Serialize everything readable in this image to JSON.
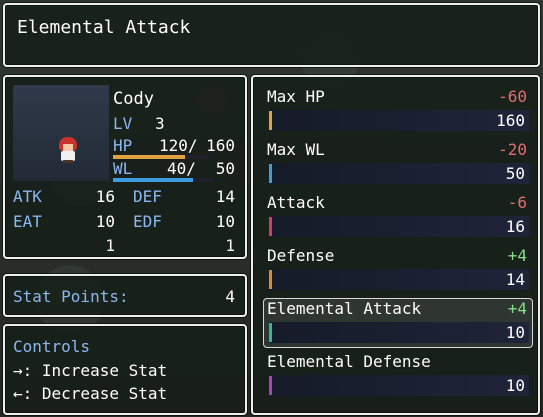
{
  "help": {
    "text": "Elemental Attack"
  },
  "actor": {
    "name": "Cody",
    "lv_label": "LV",
    "level": "3",
    "hp_label": "HP",
    "hp": "120/",
    "hp_max": "160",
    "hp_fraction": 0.75,
    "wl_label": "WL",
    "wl": "40/",
    "wl_max": "50",
    "wl_fraction": 0.8,
    "colors": {
      "hp_gauge": "#e0a243",
      "wl_gauge": "#3a9ee0"
    },
    "stats": [
      {
        "label": "ATK",
        "value": "16"
      },
      {
        "label": "DEF",
        "value": "14"
      },
      {
        "label": "EAT",
        "value": "10"
      },
      {
        "label": "EDF",
        "value": "10"
      },
      {
        "label": "",
        "value": "1"
      },
      {
        "label": "",
        "value": "1"
      }
    ]
  },
  "stat_points": {
    "label": "Stat Points:",
    "value": "4"
  },
  "controls": {
    "title": "Controls",
    "increase": "→: Increase Stat",
    "decrease": "←: Decrease Stat"
  },
  "params": {
    "selected_index": 4,
    "items": [
      {
        "name": "Max HP",
        "delta": "-60",
        "value": "160",
        "color": "#e0a243"
      },
      {
        "name": "Max WL",
        "delta": "-20",
        "value": "50",
        "color": "#3a9ee0"
      },
      {
        "name": "Attack",
        "delta": "-6",
        "value": "16",
        "color": "#d04060"
      },
      {
        "name": "Defense",
        "delta": "+4",
        "value": "14",
        "color": "#e08a30"
      },
      {
        "name": "Elemental Attack",
        "delta": "+4",
        "value": "10",
        "color": "#30b898"
      },
      {
        "name": "Elemental Defense",
        "delta": "",
        "value": "10",
        "color": "#b040c8"
      }
    ]
  }
}
